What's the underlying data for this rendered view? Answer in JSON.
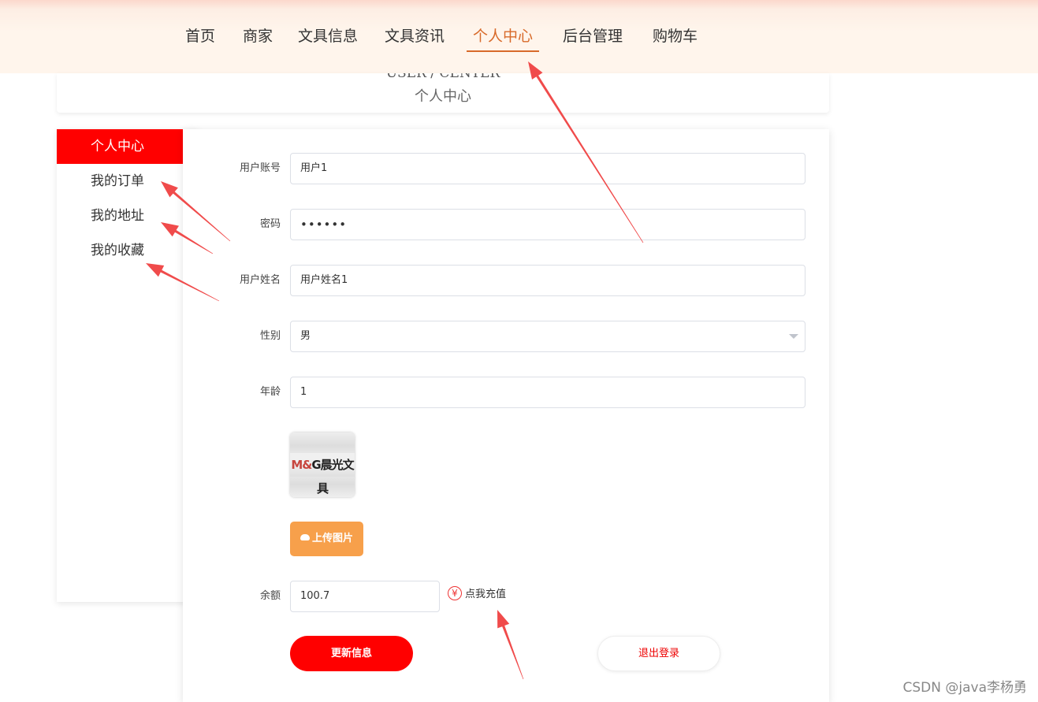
{
  "nav": {
    "items": [
      {
        "label": "首页"
      },
      {
        "label": "商家"
      },
      {
        "label": "文具信息"
      },
      {
        "label": "文具资讯"
      },
      {
        "label": "个人中心"
      },
      {
        "label": "后台管理"
      },
      {
        "label": "购物车"
      }
    ],
    "active_label": "个人中心"
  },
  "header": {
    "title_en": "USER / CENTER",
    "title_zh": "个人中心"
  },
  "sidebar": {
    "items": [
      {
        "label": "个人中心"
      },
      {
        "label": "我的订单"
      },
      {
        "label": "我的地址"
      },
      {
        "label": "我的收藏"
      }
    ]
  },
  "form": {
    "account_label": "用户账号",
    "account_value": "用户1",
    "password_label": "密码",
    "password_value": "••••••",
    "name_label": "用户姓名",
    "name_value": "用户姓名1",
    "gender_label": "性别",
    "gender_value": "男",
    "age_label": "年龄",
    "age_value": "1",
    "avatar_text_red": "M&",
    "avatar_text_dark": "G晨光文具",
    "upload_label": "上传图片",
    "balance_label": "余额",
    "balance_value": "100.7",
    "recharge_symbol": "¥",
    "recharge_label": "点我充值",
    "update_label": "更新信息",
    "logout_label": "退出登录"
  },
  "annotation_color": "#f04b4b",
  "watermark": "CSDN @java李杨勇"
}
